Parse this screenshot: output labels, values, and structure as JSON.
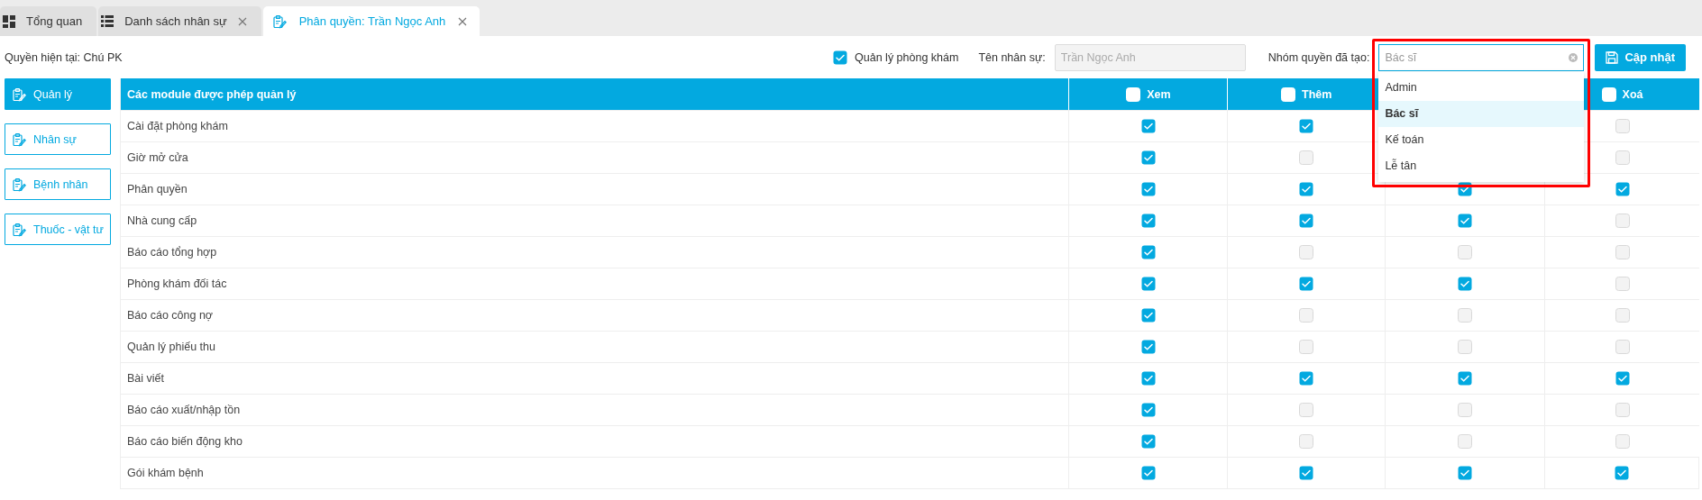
{
  "tabs": [
    {
      "label": "Tổng quan",
      "kind": "dashboard",
      "closable": false,
      "selected": false
    },
    {
      "label": "Danh sách nhân sự",
      "kind": "list",
      "closable": true,
      "selected": false
    },
    {
      "label": "Phân quyền: Trần Ngọc Anh",
      "kind": "clipboard",
      "closable": true,
      "selected": true
    }
  ],
  "toolbar": {
    "current_role": "Quyền hiện tại: Chú PK",
    "clinic_manager": {
      "label": "Quản lý phòng khám",
      "checked": true
    },
    "staff_name": {
      "label": "Tên nhân sự:",
      "value": "Trần Ngọc Anh",
      "disabled": true
    },
    "role_group": {
      "label": "Nhóm quyền đã tạo:",
      "value": "Bác sĩ",
      "expanded": true,
      "highlighted": true,
      "options": [
        {
          "label": "Admin",
          "selected": false
        },
        {
          "label": "Bác sĩ",
          "selected": true
        },
        {
          "label": "Kế toán",
          "selected": false
        },
        {
          "label": "Lễ tân",
          "selected": false
        }
      ]
    },
    "update_button": "Cập nhật"
  },
  "sidebar": {
    "items": [
      {
        "label": "Quản lý",
        "selected": true
      },
      {
        "label": "Nhân sự",
        "selected": false
      },
      {
        "label": "Bệnh nhân",
        "selected": false
      },
      {
        "label": "Thuốc - vật tư",
        "selected": false
      }
    ]
  },
  "table": {
    "columns": [
      {
        "kind": "text",
        "label": "Các module được phép quản lý"
      },
      {
        "kind": "permission",
        "label": "Xem",
        "checked": false
      },
      {
        "kind": "permission",
        "label": "Thêm",
        "checked": false
      },
      {
        "kind": "covered"
      },
      {
        "kind": "permission",
        "label": "Xoá",
        "checked": false
      }
    ],
    "rows": [
      {
        "module": "Cài đặt phòng khám",
        "permissions": [
          {
            "kind": "checkbox",
            "checked": true
          },
          {
            "kind": "checkbox",
            "checked": true
          },
          {
            "kind": "covered"
          },
          {
            "kind": "checkbox",
            "checked": false
          }
        ]
      },
      {
        "module": "Giờ mở cửa",
        "permissions": [
          {
            "kind": "checkbox",
            "checked": true
          },
          {
            "kind": "checkbox",
            "checked": false
          },
          {
            "kind": "covered"
          },
          {
            "kind": "checkbox",
            "checked": false
          }
        ]
      },
      {
        "module": "Phân quyền",
        "permissions": [
          {
            "kind": "checkbox",
            "checked": true
          },
          {
            "kind": "checkbox",
            "checked": true
          },
          {
            "kind": "checkbox",
            "checked": true
          },
          {
            "kind": "checkbox",
            "checked": true
          }
        ]
      },
      {
        "module": "Nhà cung cấp",
        "permissions": [
          {
            "kind": "checkbox",
            "checked": true
          },
          {
            "kind": "checkbox",
            "checked": true
          },
          {
            "kind": "checkbox",
            "checked": true
          },
          {
            "kind": "checkbox",
            "checked": false
          }
        ]
      },
      {
        "module": "Báo cáo tổng hợp",
        "permissions": [
          {
            "kind": "checkbox",
            "checked": true
          },
          {
            "kind": "checkbox",
            "checked": false
          },
          {
            "kind": "checkbox",
            "checked": false
          },
          {
            "kind": "checkbox",
            "checked": false
          }
        ]
      },
      {
        "module": "Phòng khám đối tác",
        "permissions": [
          {
            "kind": "checkbox",
            "checked": true
          },
          {
            "kind": "checkbox",
            "checked": true
          },
          {
            "kind": "checkbox",
            "checked": true
          },
          {
            "kind": "checkbox",
            "checked": false
          }
        ]
      },
      {
        "module": "Báo cáo công nợ",
        "permissions": [
          {
            "kind": "checkbox",
            "checked": true
          },
          {
            "kind": "checkbox",
            "checked": false
          },
          {
            "kind": "checkbox",
            "checked": false
          },
          {
            "kind": "checkbox",
            "checked": false
          }
        ]
      },
      {
        "module": "Quản lý phiếu thu",
        "permissions": [
          {
            "kind": "checkbox",
            "checked": true
          },
          {
            "kind": "checkbox",
            "checked": false
          },
          {
            "kind": "checkbox",
            "checked": false
          },
          {
            "kind": "checkbox",
            "checked": false
          }
        ]
      },
      {
        "module": "Bài viết",
        "permissions": [
          {
            "kind": "checkbox",
            "checked": true
          },
          {
            "kind": "checkbox",
            "checked": true
          },
          {
            "kind": "checkbox",
            "checked": true
          },
          {
            "kind": "checkbox",
            "checked": true
          }
        ]
      },
      {
        "module": "Báo cáo xuất/nhập tồn",
        "permissions": [
          {
            "kind": "checkbox",
            "checked": true
          },
          {
            "kind": "checkbox",
            "checked": false
          },
          {
            "kind": "checkbox",
            "checked": false
          },
          {
            "kind": "checkbox",
            "checked": false
          }
        ]
      },
      {
        "module": "Báo cáo biến động kho",
        "permissions": [
          {
            "kind": "checkbox",
            "checked": true
          },
          {
            "kind": "checkbox",
            "checked": false
          },
          {
            "kind": "checkbox",
            "checked": false
          },
          {
            "kind": "checkbox",
            "checked": false
          }
        ]
      },
      {
        "module": "Gói khám bệnh",
        "permissions": [
          {
            "kind": "checkbox",
            "checked": true
          },
          {
            "kind": "checkbox",
            "checked": true
          },
          {
            "kind": "checkbox",
            "checked": true
          },
          {
            "kind": "checkbox",
            "checked": true
          }
        ]
      }
    ]
  }
}
